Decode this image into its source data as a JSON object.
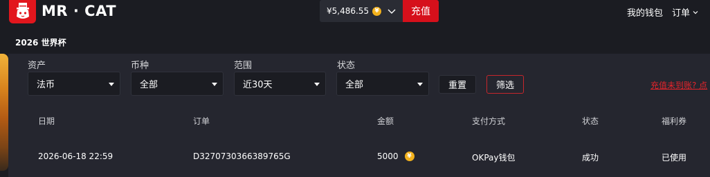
{
  "header": {
    "brand": "MR · CAT",
    "wallet_balance": "¥5,486.55",
    "coin_symbol": "¥",
    "recharge_label": "充值",
    "my_wallet_label": "我的钱包",
    "orders_label": "订单"
  },
  "subnav": {
    "title": "2026 世界杯"
  },
  "filters": {
    "asset": {
      "label": "资产",
      "value": "法币"
    },
    "currency": {
      "label": "币种",
      "value": "全部"
    },
    "range": {
      "label": "范围",
      "value": "近30天"
    },
    "status": {
      "label": "状态",
      "value": "全部"
    },
    "reset_label": "重置",
    "filter_label": "筛选",
    "help_link": "充值未到账? 点"
  },
  "table": {
    "columns": [
      "日期",
      "订单",
      "金额",
      "支付方式",
      "状态",
      "福利券"
    ],
    "rows": [
      {
        "date": "2026-06-18 22:59",
        "order": "D3270730366389765G",
        "amount": "5000",
        "coin_symbol": "¥",
        "payment": "OKPay钱包",
        "status": "成功",
        "coupon": "已使用"
      }
    ]
  },
  "colors": {
    "accent": "#d6101b",
    "coin": "#f2b11c",
    "background": "#1b1c22",
    "panel": "#25262f",
    "link": "#e3242b"
  },
  "icons": {
    "logo": "cat-with-top-hat-logo",
    "caret": "chevron-down-icon",
    "coin": "yen-coin-icon"
  }
}
